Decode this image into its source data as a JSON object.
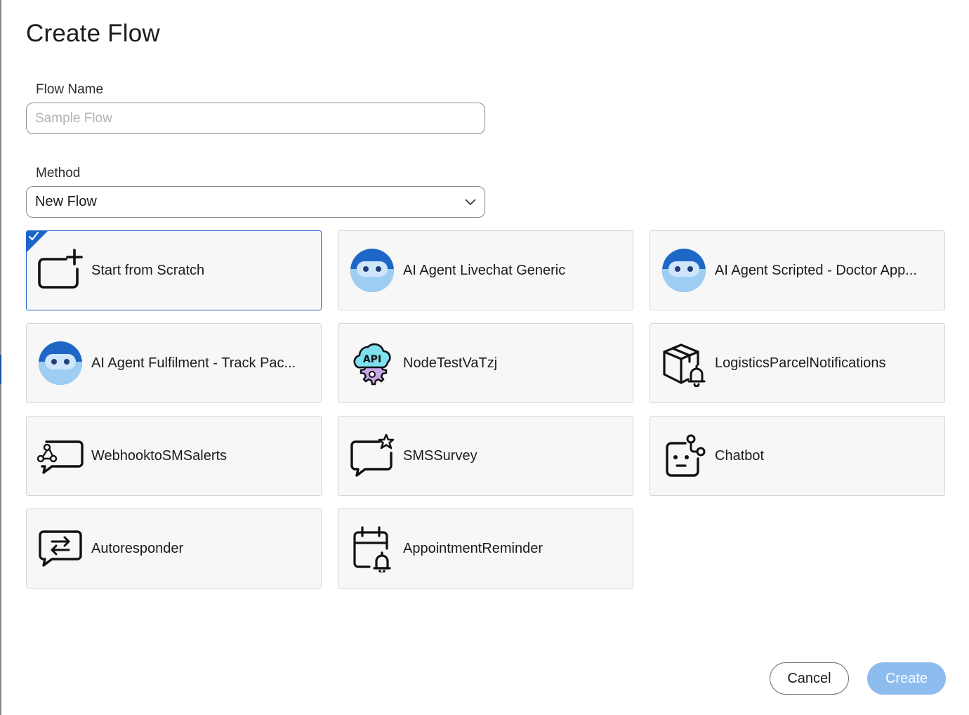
{
  "dialog": {
    "title": "Create Flow",
    "flow_name": {
      "label": "Flow Name",
      "value": "",
      "placeholder": "Sample Flow"
    },
    "method": {
      "label": "Method",
      "selected": "New Flow"
    },
    "templates": [
      {
        "label": "Start from Scratch",
        "icon": "add-canvas-icon",
        "selected": true
      },
      {
        "label": "AI Agent Livechat Generic",
        "icon": "ai-agent-icon",
        "selected": false
      },
      {
        "label": "AI Agent Scripted - Doctor App...",
        "icon": "ai-agent-icon",
        "selected": false
      },
      {
        "label": "AI Agent Fulfilment - Track Pac...",
        "icon": "ai-agent-icon",
        "selected": false
      },
      {
        "label": "NodeTestVaTzj",
        "icon": "api-cloud-icon",
        "selected": false
      },
      {
        "label": "LogisticsParcelNotifications",
        "icon": "parcel-bell-icon",
        "selected": false
      },
      {
        "label": "WebhooktoSMSalerts",
        "icon": "webhook-chat-icon",
        "selected": false
      },
      {
        "label": "SMSSurvey",
        "icon": "chat-star-icon",
        "selected": false
      },
      {
        "label": "Chatbot",
        "icon": "chatbot-icon",
        "selected": false
      },
      {
        "label": "Autoresponder",
        "icon": "chat-arrows-icon",
        "selected": false
      },
      {
        "label": "AppointmentReminder",
        "icon": "calendar-bell-icon",
        "selected": false
      }
    ],
    "buttons": {
      "cancel": "Cancel",
      "create": "Create"
    },
    "colors": {
      "accent": "#1d64c9",
      "create_disabled": "#8dbcef",
      "card_bg": "#f7f7f7",
      "ai_agent_blue": "#1f67c7"
    }
  }
}
